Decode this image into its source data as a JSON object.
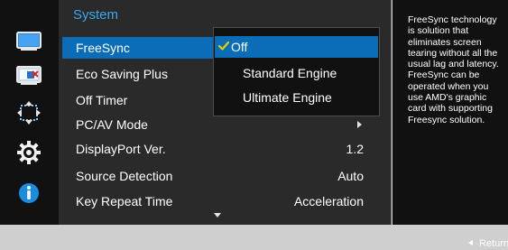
{
  "panel": {
    "title": "System"
  },
  "menu": {
    "items": [
      {
        "label": "FreeSync",
        "value": "",
        "selected": true
      },
      {
        "label": "Eco Saving Plus",
        "value": ""
      },
      {
        "label": "Off Timer",
        "value": ""
      },
      {
        "label": "PC/AV Mode",
        "value": ""
      },
      {
        "label": "DisplayPort Ver.",
        "value": "1.2"
      },
      {
        "label": "Source Detection",
        "value": "Auto"
      },
      {
        "label": "Key Repeat Time",
        "value": "Acceleration"
      }
    ]
  },
  "submenu": {
    "items": [
      {
        "label": "Off",
        "checked": true
      },
      {
        "label": "Standard Engine"
      },
      {
        "label": "Ultimate Engine"
      }
    ]
  },
  "help": {
    "text": "FreeSync technology is solution that eliminates screen tearing without all the usual lag and latency. FreeSync can be operated when you use AMD's graphic card with supporting Freesync solution."
  },
  "footer": {
    "return_label": "Return"
  },
  "icons": {
    "sidebar": [
      "picture-icon",
      "color-icon",
      "size-position-icon",
      "gear-icon",
      "info-icon"
    ],
    "check": "check-icon",
    "submenu_arrow": "chevron-right-icon",
    "scroll_down": "chevron-down-icon",
    "return_arrow": "return-arrow-icon"
  },
  "colors": {
    "accent": "#0b6db8",
    "title": "#39aaf0",
    "menu_background": "#2a2a2a",
    "sidebar_background": "#111111",
    "check": "#e6d000"
  }
}
